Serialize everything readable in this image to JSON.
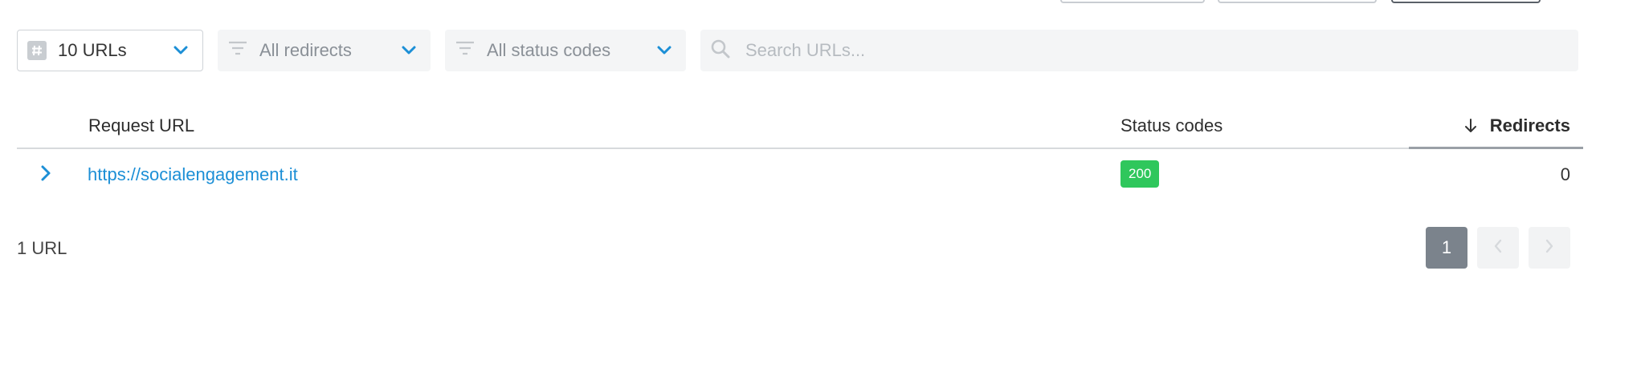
{
  "filters": {
    "count_select": {
      "value": "10 URLs",
      "icon": "hash-icon"
    },
    "redirects_select": {
      "value": "All redirects",
      "icon": "filter-icon"
    },
    "status_select": {
      "value": "All status codes",
      "icon": "filter-icon"
    },
    "search": {
      "placeholder": "Search URLs...",
      "value": ""
    }
  },
  "table": {
    "columns": {
      "request_url": "Request URL",
      "status_codes": "Status codes",
      "redirects": "Redirects"
    },
    "sort": {
      "column": "redirects",
      "direction": "descending",
      "icon": "arrow-down-icon"
    },
    "rows": [
      {
        "url": "https://socialengagement.it",
        "status": "200",
        "redirects": "0"
      }
    ]
  },
  "footer": {
    "count_label": "1 URL",
    "pagination": {
      "current_page": "1"
    }
  },
  "colors": {
    "accent": "#1c8fd6",
    "status_ok": "#2fc75c",
    "pager_active": "#7b838c"
  }
}
